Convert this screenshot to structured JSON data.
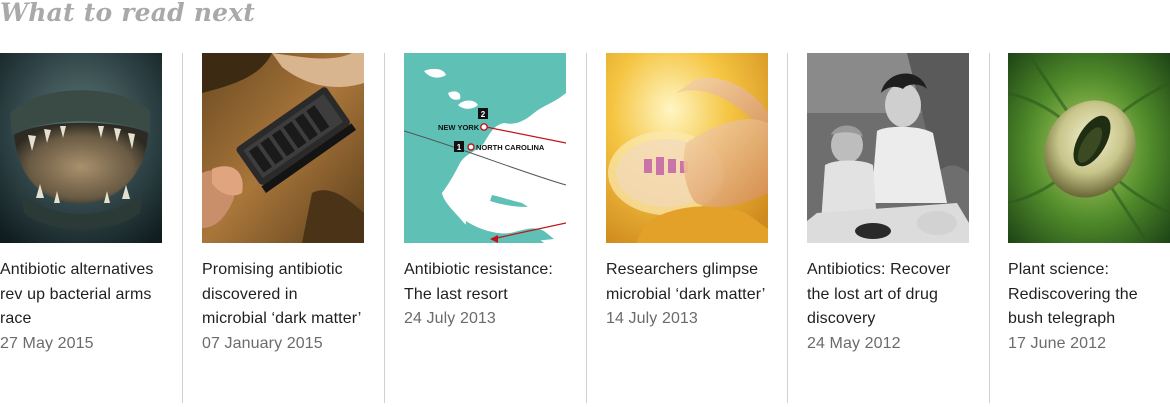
{
  "section": {
    "heading": "What to read next"
  },
  "articles": [
    {
      "title": "Antibiotic alternatives rev up bacterial arms race",
      "date": "27 May 2015"
    },
    {
      "title": "Promising antibiotic discovered in microbial ‘dark matter’",
      "date": "07 January 2015"
    },
    {
      "title": "Antibiotic resistance: The last resort",
      "date": "24 July 2013",
      "map_labels": {
        "marker1": "1",
        "marker2": "2",
        "city1": "NORTH CAROLINA",
        "city2": "NEW YORK"
      }
    },
    {
      "title": "Researchers glimpse microbial ‘dark matter’",
      "date": "14 July 2013"
    },
    {
      "title": "Antibiotics: Recover the lost art of drug discovery",
      "date": "24 May 2012"
    },
    {
      "title": "Plant science: Rediscovering the bush telegraph",
      "date": "17 June 2012"
    }
  ]
}
